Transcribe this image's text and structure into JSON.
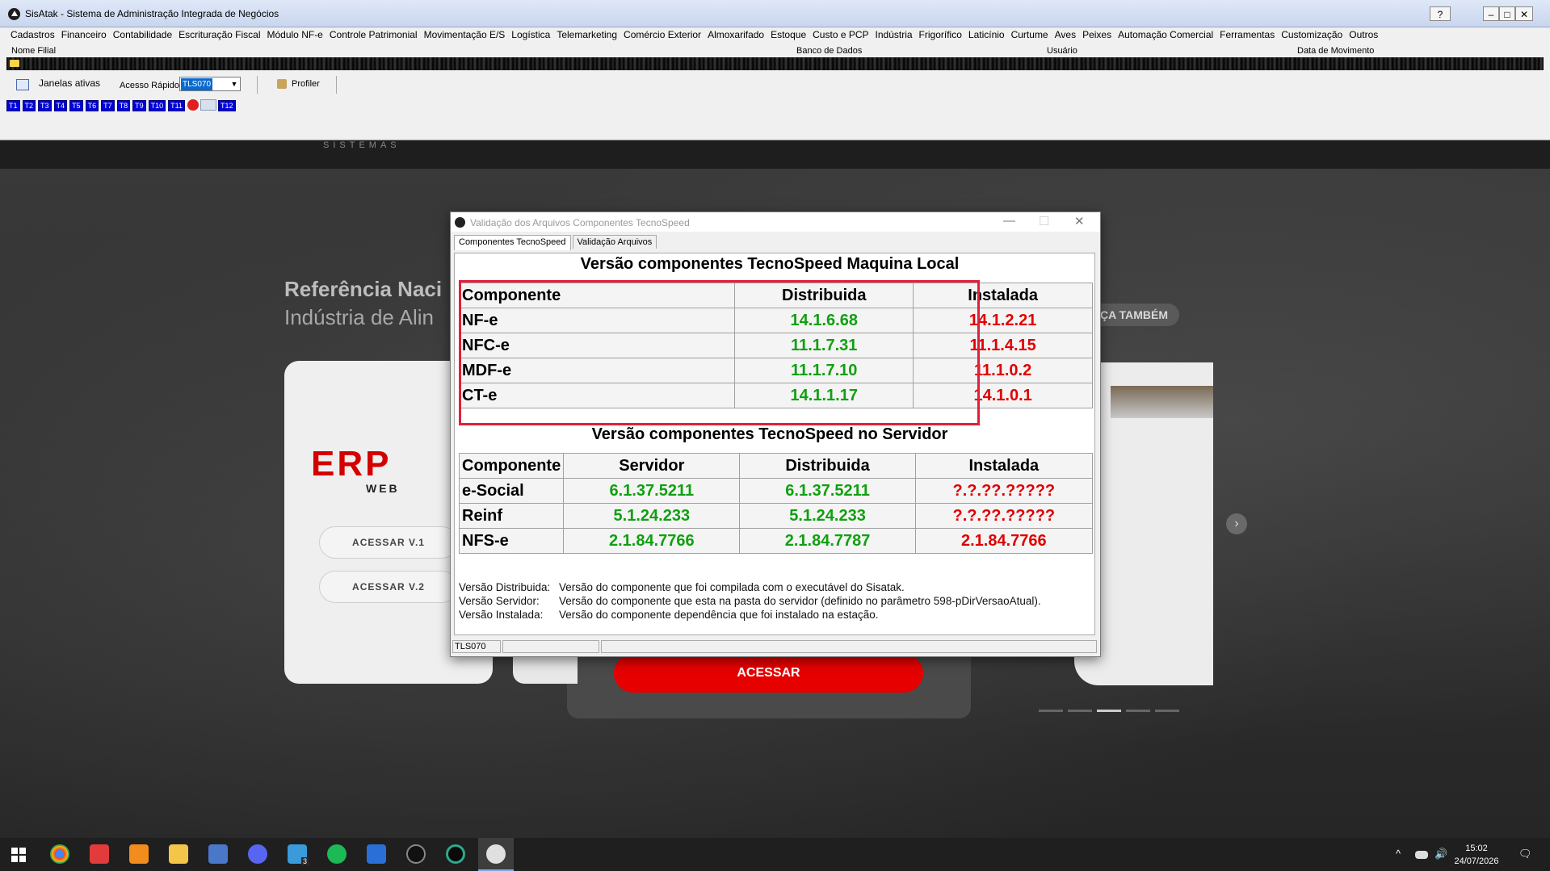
{
  "app": {
    "title": "SisAtak - Sistema de Administração Integrada de Negócios",
    "help_btn": "?",
    "minimize_btn": "–",
    "maximize_btn": "□",
    "close_btn": "✕",
    "menu": [
      "Cadastros",
      "Financeiro",
      "Contabilidade",
      "Escrituração Fiscal",
      "Módulo NF-e",
      "Controle Patrimonial",
      "Movimentação E/S",
      "Logística",
      "Telemarketing",
      "Comércio Exterior",
      "Almoxarifado",
      "Estoque",
      "Custo e PCP",
      "Indústria",
      "Frigorífico",
      "Laticínio",
      "Curtume",
      "Aves",
      "Peixes",
      "Automação Comercial",
      "Ferramentas",
      "Customização",
      "Outros"
    ],
    "info": {
      "nome_filial": "Nome Filial",
      "banco": "Banco de Dados",
      "usuario": "Usuário",
      "data_mov": "Data de Movimento"
    },
    "toolbar": {
      "janelas": "Janelas ativas",
      "acesso_label": "Acesso Rápido",
      "acesso_value": "TLS070",
      "dropdown_arrow": "▼",
      "profiler": "Profiler"
    },
    "tabs": [
      "T1",
      "T2",
      "T3",
      "T4",
      "T5",
      "T6",
      "T7",
      "T8",
      "T9",
      "T10",
      "T11",
      "T12"
    ]
  },
  "background": {
    "sistemas": "SISTEMAS",
    "title1": "Referência Naci",
    "title2": "Indústria de Alin",
    "pill": "ÇA TAMBÉM",
    "erp": "ERP",
    "web": "WEB",
    "btn_v1": "ACESSAR V.1",
    "btn_v2": "ACESSAR V.2",
    "acessar": "ACESSAR",
    "arrow": "›"
  },
  "dialog": {
    "title": "Validação dos Arquivos Componentes TecnoSpeed",
    "min": "—",
    "max": "☐",
    "close": "✕",
    "tabs": [
      "Componentes TecnoSpeed",
      "Validação Arquivos"
    ],
    "local": {
      "title": "Versão componentes TecnoSpeed Maquina Local",
      "headers": [
        "Componente",
        "Distribuida",
        "Instalada"
      ],
      "rows": [
        {
          "name": "NF-e",
          "distribuida": "14.1.6.68",
          "instalada": "14.1.2.21"
        },
        {
          "name": "NFC-e",
          "distribuida": "11.1.7.31",
          "instalada": "11.1.4.15"
        },
        {
          "name": "MDF-e",
          "distribuida": "11.1.7.10",
          "instalada": "11.1.0.2"
        },
        {
          "name": "CT-e",
          "distribuida": "14.1.1.17",
          "instalada": "14.1.0.1"
        }
      ]
    },
    "server": {
      "title": "Versão componentes TecnoSpeed no Servidor",
      "headers": [
        "Componente",
        "Servidor",
        "Distribuida",
        "Instalada"
      ],
      "rows": [
        {
          "name": "e-Social",
          "servidor": "6.1.37.5211",
          "distribuida": "6.1.37.5211",
          "instalada": "?.?.??.?????"
        },
        {
          "name": "Reinf",
          "servidor": "5.1.24.233",
          "distribuida": "5.1.24.233",
          "instalada": "?.?.??.?????"
        },
        {
          "name": "NFS-e",
          "servidor": "2.1.84.7766",
          "distribuida": "2.1.84.7787",
          "instalada": "2.1.84.7766"
        }
      ]
    },
    "legend": [
      {
        "k": "Versão Distribuida:",
        "v": "Versão do componente que foi compilada com o executável do Sisatak."
      },
      {
        "k": "Versão Servidor:",
        "v": "Versão do componente que esta na pasta do servidor (definido no parâmetro 598-pDirVersaoAtual)."
      },
      {
        "k": "Versão Instalada:",
        "v": "Versão do componente dependência que foi instalado na estação."
      }
    ],
    "status": "TLS070",
    "colors": {
      "ok": "#10a010",
      "bad": "#e00000",
      "highlight": "#e0203a"
    }
  },
  "taskbar": {
    "time": "15:02",
    "date": "24/07/2026",
    "tray_up": "^",
    "volume": "🔊",
    "notifications": "🗨",
    "badge": "3"
  }
}
